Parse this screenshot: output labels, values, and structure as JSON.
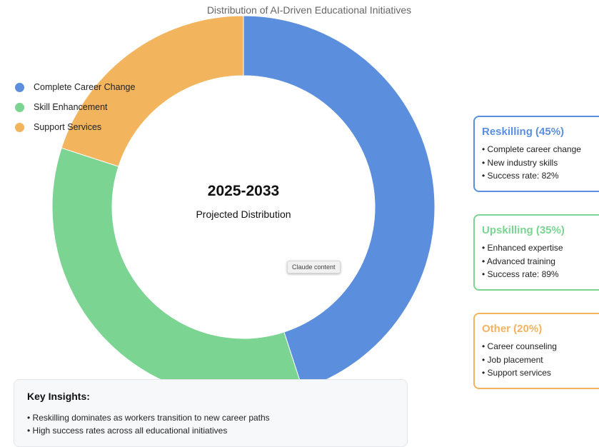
{
  "chart_data": {
    "type": "pie",
    "title": "Distribution of AI-Driven Educational Initiatives",
    "categories": [
      "Complete Career Change",
      "Skill Enhancement",
      "Support Services"
    ],
    "values": [
      45,
      35,
      20
    ],
    "colors": [
      "#5b8fdd",
      "#7bd492",
      "#f2b45c"
    ],
    "donut": true,
    "legend_placement": "top-left",
    "center_title": "2025-2033",
    "center_subtitle": "Projected Distribution"
  },
  "tooltip": "Claude content",
  "cards": [
    {
      "title": "Reskilling (45%)",
      "color": "#5b8fdd",
      "lines": [
        "• Complete career change",
        "• New industry skills",
        "• Success rate: 82%"
      ]
    },
    {
      "title": "Upskilling (35%)",
      "color": "#7bd492",
      "lines": [
        "• Enhanced expertise",
        "• Advanced training",
        "• Success rate: 89%"
      ]
    },
    {
      "title": "Other (20%)",
      "color": "#f2b45c",
      "lines": [
        "• Career counseling",
        "• Job placement",
        "• Support services"
      ]
    }
  ],
  "insights": {
    "title": "Key Insights:",
    "lines": [
      "• Reskilling dominates as workers transition to new career paths",
      "• High success rates across all educational initiatives"
    ]
  }
}
